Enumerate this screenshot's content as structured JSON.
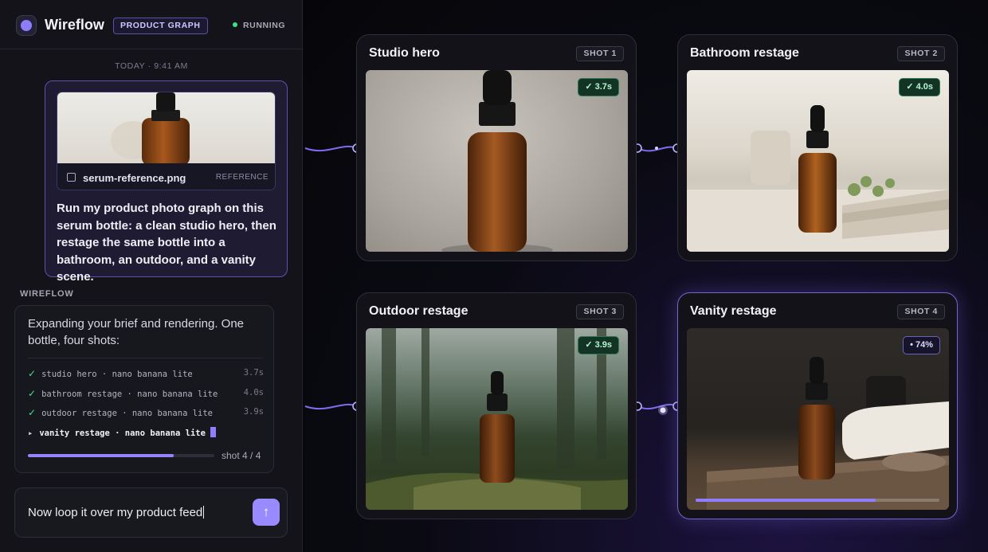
{
  "app": {
    "name": "Wireflow",
    "mode_badge": "PRODUCT GRAPH",
    "status": "RUNNING",
    "status_color": "#3ee08a",
    "accent": "#9584ff"
  },
  "chat": {
    "timestamp": "TODAY · 9:41 AM",
    "user_message": {
      "attachment": {
        "filename": "serum-reference.png",
        "tag": "REFERENCE",
        "icon": "image-icon"
      },
      "text": "Run my product photo graph on this serum bottle: a clean studio hero, then restage the same bottle into a bathroom, an outdoor, and a vanity scene."
    },
    "assistant": {
      "label": "WIREFLOW",
      "text": "Expanding your brief and rendering. One bottle, four shots:",
      "steps": [
        {
          "label": "studio hero · nano banana lite",
          "time": "3.7s",
          "state": "done"
        },
        {
          "label": "bathroom restage · nano banana lite",
          "time": "4.0s",
          "state": "done"
        },
        {
          "label": "outdoor restage · nano banana lite",
          "time": "3.9s",
          "state": "done"
        },
        {
          "label": "vanity restage · nano banana lite",
          "time": "",
          "state": "running"
        }
      ],
      "progress": 0.78,
      "progress_label": "shot 4 / 4"
    },
    "composer": {
      "value": "Now loop it over my product feed",
      "send_icon": "arrow-up-icon"
    }
  },
  "graph": {
    "cards": [
      {
        "title": "Studio hero",
        "shot": "SHOT 1",
        "badge": "✓ 3.7s",
        "scene": "studio",
        "state": "done"
      },
      {
        "title": "Bathroom restage",
        "shot": "SHOT 2",
        "badge": "✓ 4.0s",
        "scene": "bathroom",
        "state": "done"
      },
      {
        "title": "Outdoor restage",
        "shot": "SHOT 3",
        "badge": "✓ 3.9s",
        "scene": "forest",
        "state": "done"
      },
      {
        "title": "Vanity restage",
        "shot": "SHOT 4",
        "badge": "• 74%",
        "scene": "vanity",
        "state": "running",
        "progress": 0.74
      }
    ]
  }
}
